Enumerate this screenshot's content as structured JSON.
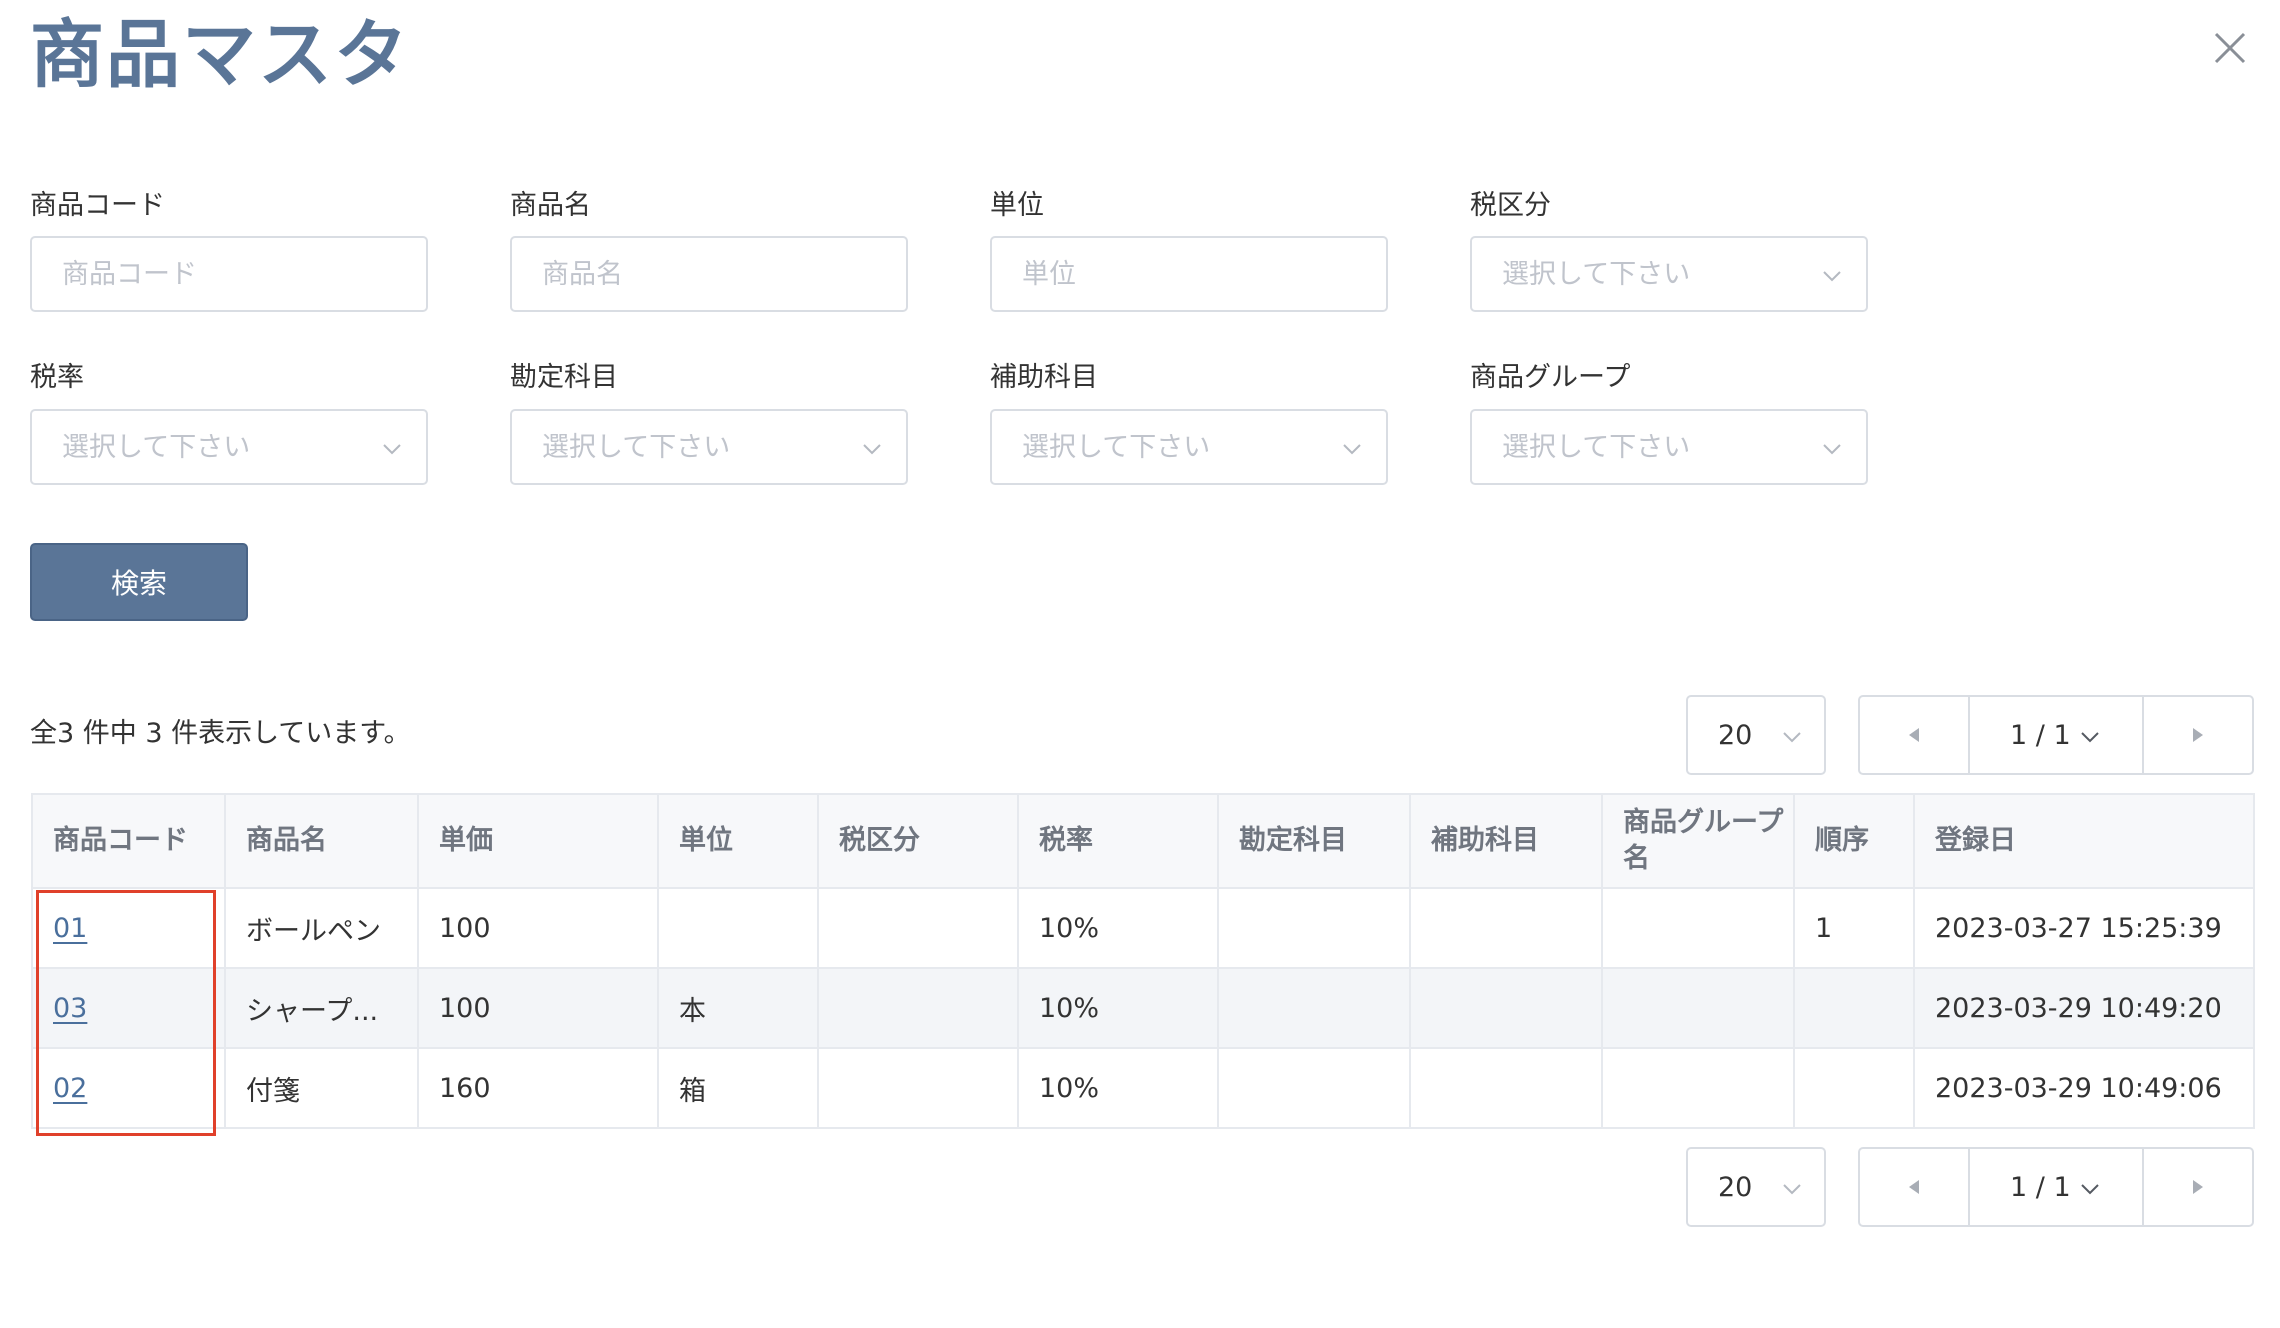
{
  "page": {
    "title": "商品マスタ"
  },
  "filters": {
    "product_code": {
      "label": "商品コード",
      "placeholder": "商品コード"
    },
    "product_name": {
      "label": "商品名",
      "placeholder": "商品名"
    },
    "unit": {
      "label": "単位",
      "placeholder": "単位"
    },
    "tax_category": {
      "label": "税区分",
      "placeholder": "選択して下さい"
    },
    "tax_rate": {
      "label": "税率",
      "placeholder": "選択して下さい"
    },
    "account": {
      "label": "勘定科目",
      "placeholder": "選択して下さい"
    },
    "sub_account": {
      "label": "補助科目",
      "placeholder": "選択して下さい"
    },
    "product_group": {
      "label": "商品グループ",
      "placeholder": "選択して下さい"
    }
  },
  "search_button": {
    "label": "検索"
  },
  "results": {
    "summary": "全3 件中 3 件表示しています。",
    "page_size": "20",
    "page_indicator": "1 / 1"
  },
  "table": {
    "columns": [
      "商品コード",
      "商品名",
      "単価",
      "単位",
      "税区分",
      "税率",
      "勘定科目",
      "補助科目",
      "商品グループ名",
      "順序",
      "登録日"
    ],
    "rows": [
      {
        "code": "01",
        "name": "ボールペン",
        "price": "100",
        "unit": "",
        "tax_category": "",
        "tax_rate": "10%",
        "account": "",
        "sub_account": "",
        "group": "",
        "order": "1",
        "registered": "2023-03-27 15:25:39"
      },
      {
        "code": "03",
        "name": "シャープ...",
        "price": "100",
        "unit": "本",
        "tax_category": "",
        "tax_rate": "10%",
        "account": "",
        "sub_account": "",
        "group": "",
        "order": "",
        "registered": "2023-03-29 10:49:20"
      },
      {
        "code": "02",
        "name": "付箋",
        "price": "160",
        "unit": "箱",
        "tax_category": "",
        "tax_rate": "10%",
        "account": "",
        "sub_account": "",
        "group": "",
        "order": "",
        "registered": "2023-03-29 10:49:06"
      }
    ]
  },
  "colors": {
    "accent": "#5a7597",
    "link": "#4a6f9c",
    "highlight": "#e0402a"
  }
}
